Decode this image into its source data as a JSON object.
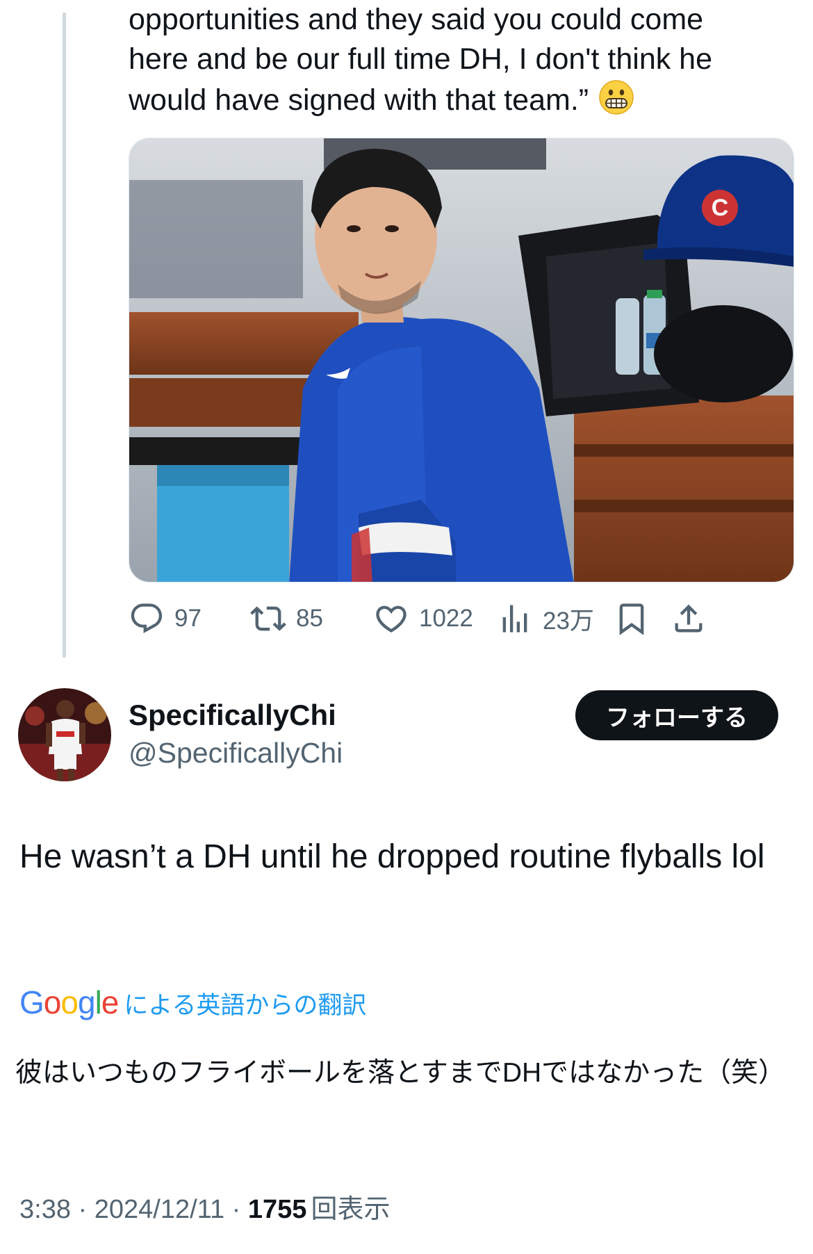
{
  "quoted_tweet": {
    "text_lines": [
      "opportunities and they said you could come",
      "here and be our full time DH, I don't think he",
      "would have signed with that team.”"
    ],
    "emoji": "grimacing-face",
    "media_icon": "cap-logo-letter",
    "cap_logo_letter": "C",
    "actions": {
      "replies": "97",
      "reposts": "85",
      "likes": "1022",
      "views": "23万"
    }
  },
  "reply": {
    "display_name": "SpecificallyChi",
    "handle": "@SpecificallyChi",
    "follow_label": "フォローする",
    "text": "He wasn’t a DH until he dropped routine flyballs lol",
    "translation_brand": "Google",
    "translation_label": "による英語からの翻訳",
    "translated_text": "彼はいつものフライボールを落とすまでDHではなかった（笑）",
    "time": "3:38",
    "separator": " · ",
    "date": "2024/12/11",
    "views_count": "1755",
    "views_label": "回表示"
  },
  "colors": {
    "text": "#0f1419",
    "muted": "#536471",
    "link": "#1d9bf0",
    "thread_line": "#cfd9de",
    "jersey_blue": "#1f4fbf",
    "cap_blue": "#0e3386",
    "cap_red": "#cc3433"
  }
}
